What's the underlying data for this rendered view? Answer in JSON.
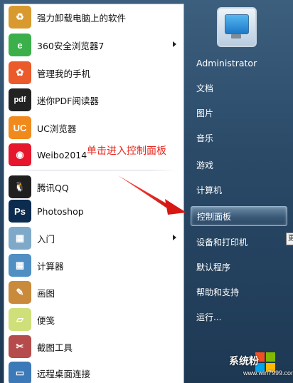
{
  "left_menu": {
    "items": [
      {
        "label": "强力卸载电脑上的软件",
        "icon": "uninstall-icon",
        "color": "#d89a2e",
        "glyph": "♻",
        "has_arrow": false
      },
      {
        "label": "360安全浏览器7",
        "icon": "360-browser-icon",
        "color": "#3bb04a",
        "glyph": "e",
        "has_arrow": true
      },
      {
        "label": "管理我的手机",
        "icon": "phone-manager-icon",
        "color": "#ea5a2a",
        "glyph": "✿",
        "has_arrow": false
      },
      {
        "label": "迷你PDF阅读器",
        "icon": "pdf-reader-icon",
        "color": "#222222",
        "glyph": "pdf",
        "has_arrow": false
      },
      {
        "label": "UC浏览器",
        "icon": "uc-browser-icon",
        "color": "#f08a1c",
        "glyph": "UC",
        "has_arrow": false
      },
      {
        "label": "Weibo2014",
        "icon": "weibo-icon",
        "color": "#e6162d",
        "glyph": "◉",
        "has_arrow": false
      },
      {
        "label": "腾讯QQ",
        "icon": "qq-icon",
        "color": "#1f1f1f",
        "glyph": "🐧",
        "has_arrow": false
      },
      {
        "label": "Photoshop",
        "icon": "photoshop-icon",
        "color": "#0b2b4f",
        "glyph": "Ps",
        "has_arrow": false
      },
      {
        "label": "入门",
        "icon": "getting-started-icon",
        "color": "#7fa9c9",
        "glyph": "▦",
        "has_arrow": true
      },
      {
        "label": "计算器",
        "icon": "calculator-icon",
        "color": "#4f8fc4",
        "glyph": "▦",
        "has_arrow": false
      },
      {
        "label": "画图",
        "icon": "paint-icon",
        "color": "#c98a3c",
        "glyph": "✎",
        "has_arrow": false
      },
      {
        "label": "便笺",
        "icon": "sticky-notes-icon",
        "color": "#cfe07a",
        "glyph": "▱",
        "has_arrow": false
      },
      {
        "label": "截图工具",
        "icon": "snipping-tool-icon",
        "color": "#b54b4b",
        "glyph": "✂",
        "has_arrow": false
      },
      {
        "label": "远程桌面连接",
        "icon": "remote-desktop-icon",
        "color": "#3c79b8",
        "glyph": "▭",
        "has_arrow": false
      }
    ]
  },
  "annotation": {
    "text": "单击进入控制面板",
    "color": "#e8281e"
  },
  "right_menu": {
    "user": "Administrator",
    "items": [
      {
        "label": "文档"
      },
      {
        "label": "图片"
      },
      {
        "label": "音乐"
      },
      {
        "label": "游戏"
      },
      {
        "label": "计算机"
      },
      {
        "label": "控制面板",
        "selected": true
      },
      {
        "label": "设备和打印机"
      },
      {
        "label": "默认程序"
      },
      {
        "label": "帮助和支持"
      },
      {
        "label": "运行..."
      }
    ]
  },
  "tooltip_edge": "更",
  "watermark": {
    "text": "系统粉",
    "url": "www.win7999.com"
  }
}
